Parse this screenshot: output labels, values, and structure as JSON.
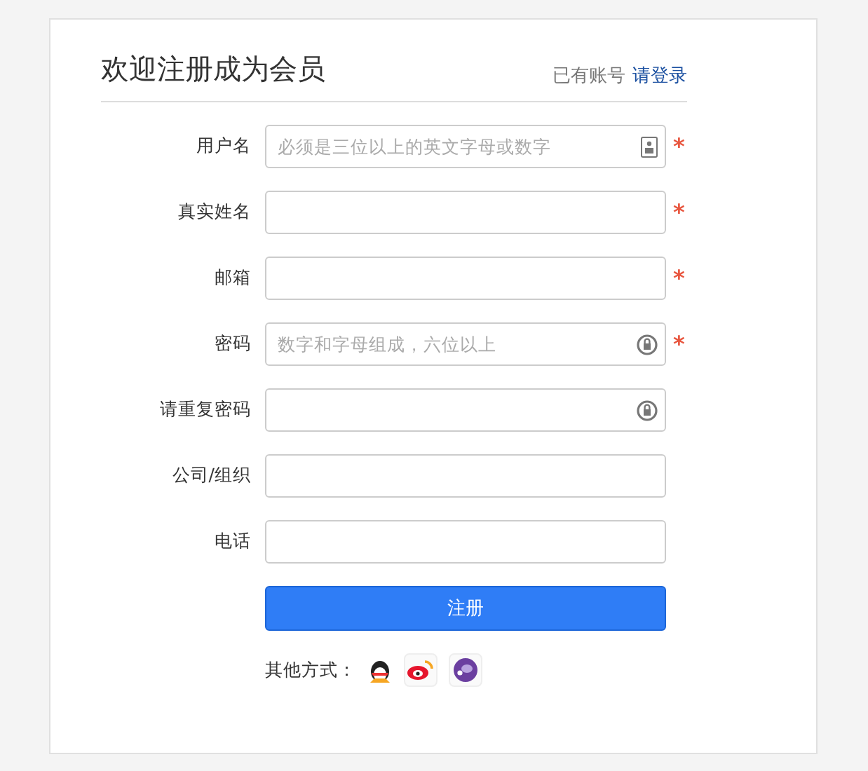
{
  "header": {
    "title": "欢迎注册成为会员",
    "account_prompt": "已有账号",
    "login_link": "请登录"
  },
  "fields": [
    {
      "label": "用户名",
      "placeholder": "必须是三位以上的英文字母或数字",
      "kind": "account",
      "required_mark": "*"
    },
    {
      "label": "真实姓名",
      "kind": "plain",
      "required_mark": "*"
    },
    {
      "label": "邮箱",
      "kind": "plain",
      "required_mark": "*"
    },
    {
      "label": "密码",
      "placeholder": "数字和字母组成，六位以上",
      "kind": "password",
      "required_mark": "*"
    },
    {
      "label": "请重复密码",
      "kind": "password"
    },
    {
      "label": "公司/组织",
      "kind": "plain"
    },
    {
      "label": "电话",
      "kind": "plain"
    }
  ],
  "submit": "注册",
  "social": {
    "label": "其他方式：",
    "items": [
      {
        "kind": "penguin"
      },
      {
        "kind": "weibo"
      },
      {
        "kind": "round"
      }
    ]
  }
}
